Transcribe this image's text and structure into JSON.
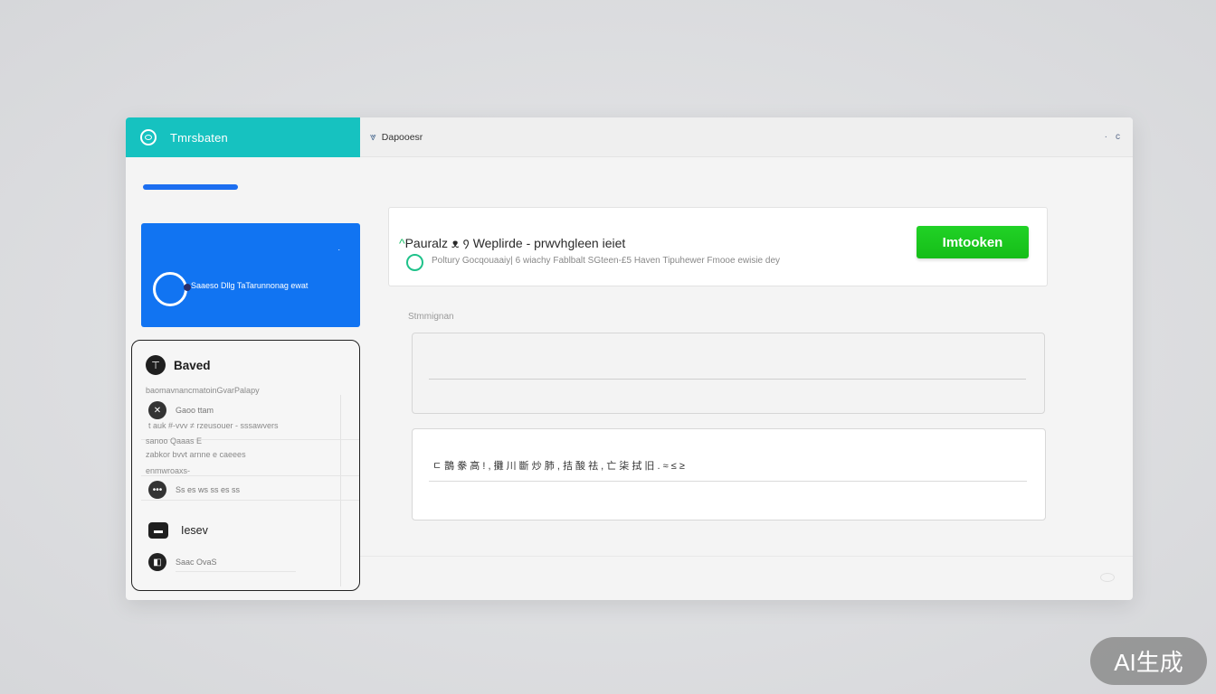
{
  "window": {
    "brand_title": "Tmrsbaten",
    "topbar_label": "Dapooesr",
    "topbar_icon": "filter-icon",
    "topbar_right": [
      "·",
      "c"
    ]
  },
  "sidebar": {
    "card_dot": ".",
    "card_label": "Saaeso Dllg TaTarunnonag ewat",
    "saved": {
      "title": "Baved",
      "subtitle": "baomavnancmatoinGvarPalapy",
      "items": [
        {
          "icon": "cross-icon",
          "text": "Gaoo ttam"
        },
        {
          "row": "t auk #-vvv ≠ rzeusouer - sssawvers"
        },
        {
          "row": "sanoo  Qaaas E"
        },
        {
          "row": "zabkor bvvt arnne e caeees"
        },
        {
          "row": "enmwroaxs-"
        },
        {
          "icon": "dots-icon",
          "text": "Ss es ws ss es ss"
        }
      ],
      "section2_title": "Iesev",
      "section2_item": "Saac  OvaS"
    }
  },
  "promo": {
    "headline_accent": "^",
    "headline": "Pauralz  ᴥ  ᠀ Weplirde -  prwvhgleen ieiet",
    "subtext": "Poltury  Gocqouaaiy|  6  wiachy  Fablbalt SGteen-£5  Haven    Tipuhewer Fmooe ewisie dey",
    "cta_label": "Imtooken"
  },
  "main": {
    "section_label": "Stmmignan",
    "text_content": "ㄷ 鵲 豢 高 ! , 攤 川 斷 炒 肺 , 拮 酸 祛 ,    亡 柒 拭 旧 .    ≈ ≤ ≥"
  },
  "badge": {
    "label": "AI生成"
  },
  "colors": {
    "brand": "#16c2c0",
    "accent_blue": "#1174f2",
    "cta_green": "#18c21b"
  }
}
